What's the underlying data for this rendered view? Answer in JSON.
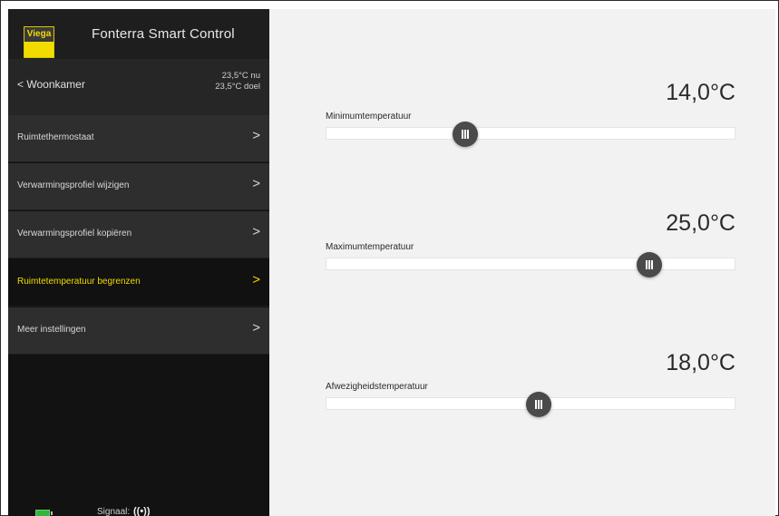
{
  "header": {
    "logo_text": "Viega",
    "app_title": "Fonterra Smart Control"
  },
  "room": {
    "back_glyph": "<",
    "name": "Woonkamer",
    "temp_now": "23,5°C nu",
    "temp_target": "23,5°C doel"
  },
  "menu": [
    {
      "label": "Ruimtethermostaat",
      "chevron": ">",
      "active": false
    },
    {
      "label": "Verwarmingsprofiel wijzigen",
      "chevron": ">",
      "active": false
    },
    {
      "label": "Verwarmingsprofiel kopiëren",
      "chevron": ">",
      "active": false
    },
    {
      "label": "Ruimtetemperatuur begrenzen",
      "chevron": ">",
      "active": true
    },
    {
      "label": "Meer instellingen",
      "chevron": ">",
      "active": false
    }
  ],
  "status": {
    "signal_label": "Signaal:",
    "signal_icon": "((•))"
  },
  "settings": [
    {
      "label": "Minimumtemperatuur",
      "value": "14,0°C",
      "slider_fraction": 0.34
    },
    {
      "label": "Maximumtemperatuur",
      "value": "25,0°C",
      "slider_fraction": 0.79
    },
    {
      "label": "Afwezigheidstemperatuur",
      "value": "18,0°C",
      "slider_fraction": 0.52
    }
  ],
  "colors": {
    "accent": "#f2dc00",
    "sidebar_bg": "#121212",
    "menu_bg": "#2e2e2e",
    "main_bg": "#f2f2f2",
    "thumb": "#4a4a4a",
    "battery": "#32b43a"
  }
}
